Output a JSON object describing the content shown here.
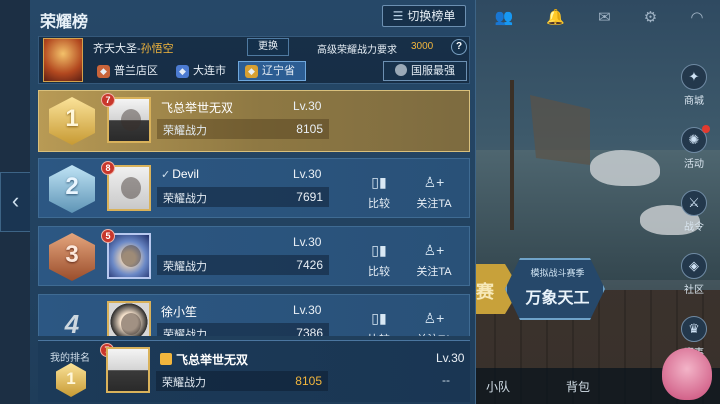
{
  "header": {
    "title": "荣耀榜",
    "switch_label": "切换榜单"
  },
  "hero": {
    "name_prefix": "齐天大圣-",
    "name_highlight": "孙悟空",
    "change_label": "更换",
    "req_label": "高级荣耀战力要求",
    "req_value": "3000",
    "help": "?"
  },
  "regions": [
    {
      "label": "普兰店区",
      "icon": "district-icon",
      "color": "#c9643a"
    },
    {
      "label": "大连市",
      "icon": "city-icon",
      "color": "#4c7bd1"
    },
    {
      "label": "辽宁省",
      "icon": "province-icon",
      "color": "#d7a032"
    }
  ],
  "server_label": "国服最强",
  "power_label": "荣耀战力",
  "actions": {
    "compare": "比较",
    "follow": "关注TA"
  },
  "rows": [
    {
      "rank": "1",
      "level_badge": "7",
      "name": "飞总举世无双",
      "tag": "",
      "level": "Lv.30",
      "power": "8105"
    },
    {
      "rank": "2",
      "level_badge": "8",
      "name": "Devil",
      "tag": "✓",
      "level": "Lv.30",
      "power": "7691"
    },
    {
      "rank": "3",
      "level_badge": "5",
      "name": "",
      "tag": "",
      "level": "Lv.30",
      "power": "7426"
    },
    {
      "rank": "4",
      "level_badge": "",
      "name": "徐小笙",
      "tag": "",
      "level": "Lv.30",
      "power": "7386"
    }
  ],
  "my_rank": {
    "label": "我的排名",
    "rank": "1",
    "level_badge": "7",
    "name": "飞总举世无双",
    "level": "Lv.30",
    "power": "8105",
    "dash": "--"
  },
  "scene": {
    "mode_left": "赛",
    "mode_sub": "模拟战斗赛季",
    "mode_title": "万象天工",
    "bottom_team": "小队",
    "bottom_bag": "背包",
    "side": [
      "商城",
      "活动",
      "战令",
      "社区",
      "赛事"
    ]
  }
}
